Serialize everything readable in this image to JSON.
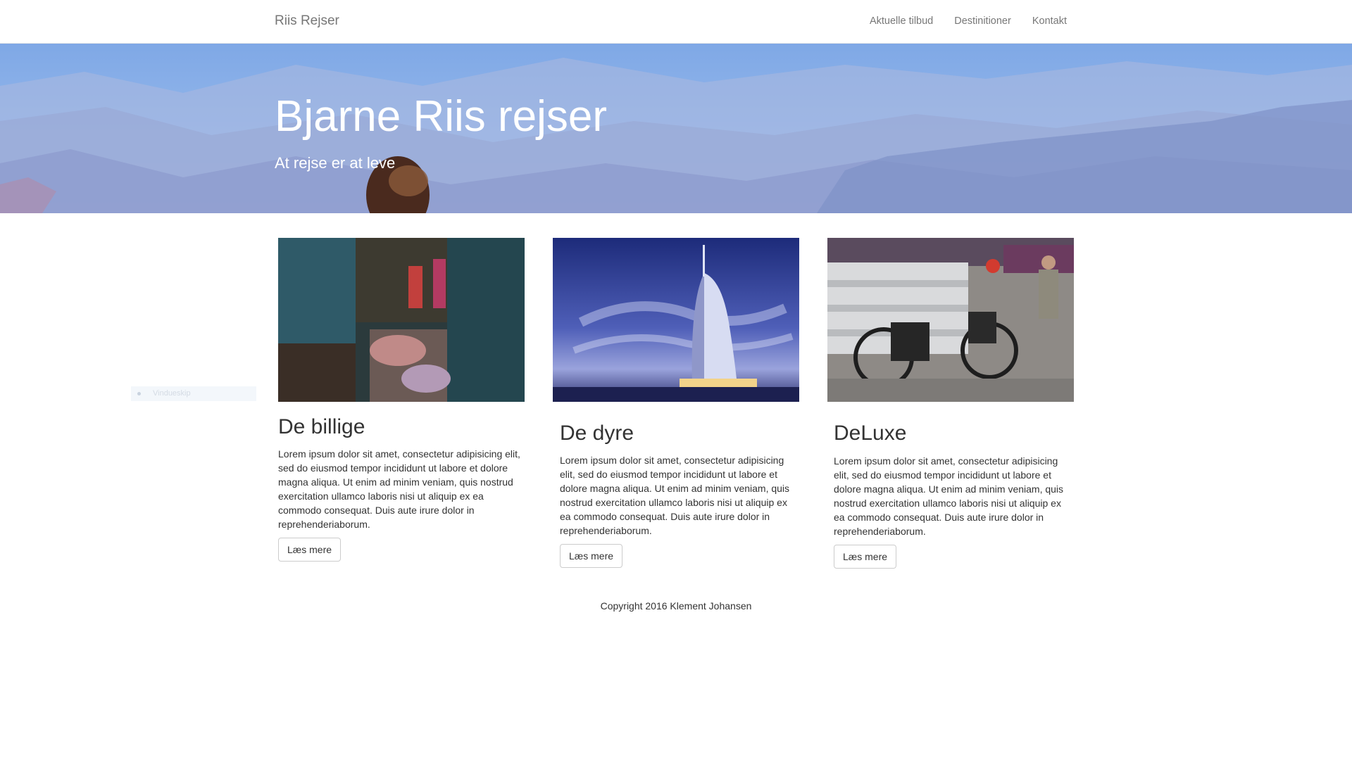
{
  "navbar": {
    "brand": "Riis Rejser",
    "links": [
      "Aktuelle tilbud",
      "Destinitioner",
      "Kontakt"
    ]
  },
  "hero": {
    "title": "Bjarne Riis rejser",
    "subtitle": "At rejse er at leve"
  },
  "cards": [
    {
      "title": "De billige",
      "text": "Lorem ipsum dolor sit amet, consectetur adipisicing elit, sed do eiusmod tempor incididunt ut labore et dolore magna aliqua. Ut enim ad minim veniam, quis nostrud exercitation ullamco laboris nisi ut aliquip ex ea commodo consequat. Duis aute irure dolor in reprehenderiaborum.",
      "button": "Læs mere"
    },
    {
      "title": "De dyre",
      "text": "Lorem ipsum dolor sit amet, consectetur adipisicing elit, sed do eiusmod tempor incididunt ut labore et dolore magna aliqua. Ut enim ad minim veniam, quis nostrud exercitation ullamco laboris nisi ut aliquip ex ea commodo consequat. Duis aute irure dolor in reprehenderiaborum.",
      "button": "Læs mere"
    },
    {
      "title": "DeLuxe",
      "text": "Lorem ipsum dolor sit amet, consectetur adipisicing elit, sed do eiusmod tempor incididunt ut labore et dolore magna aliqua. Ut enim ad minim veniam, quis nostrud exercitation ullamco laboris nisi ut aliquip ex ea commodo consequat. Duis aute irure dolor in reprehenderiaborum.",
      "button": "Læs mere"
    }
  ],
  "footer": {
    "copyright": "Copyright 2016 Klement Johansen"
  },
  "overlay": {
    "label": "Vindueskip"
  },
  "colors": {
    "navbar_bg": "#ffffff",
    "nav_text": "#777777",
    "hero_sky": "#8fb3e8",
    "button_border": "#cccccc",
    "body_text": "#333333"
  }
}
